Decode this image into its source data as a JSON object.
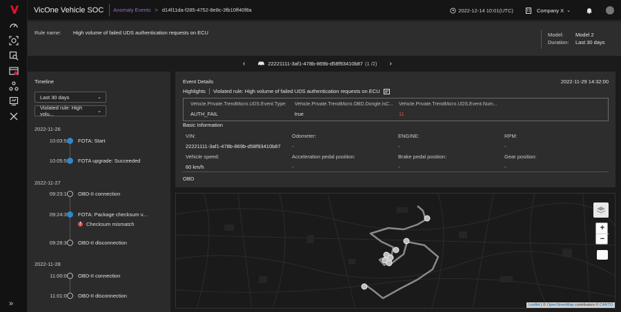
{
  "app": {
    "title": "VicOne Vehicle SOC"
  },
  "breadcrumb": {
    "parent": "Anomaly Events",
    "separator": ">",
    "current": "d14f11da-f285-4752-8e8c-3fb10ff40f8a"
  },
  "header": {
    "datetime": "2022-12-14 10:01(UTC)",
    "company": "Company X",
    "chevron": "⌄"
  },
  "sidebar": {
    "icons": [
      "dashboard-icon",
      "detection-icon",
      "investigation-icon",
      "events-icon",
      "network-icon",
      "report-icon",
      "tools-icon"
    ],
    "expand_label": "»"
  },
  "rule": {
    "label": "Rule name:",
    "name": "High volume of failed UDS authentication requests on ECU",
    "model_label": "Model:",
    "model_value": "Model 2",
    "duration_label": "Duration:",
    "duration_value": "Last 30 days"
  },
  "pager": {
    "prev": "‹",
    "next": "›",
    "vehicle_id": "22221111-3af1-478b-869b-d58f93410b87",
    "count": "(1 /2)"
  },
  "timeline": {
    "title": "Timeline",
    "range_select": "Last 30 days",
    "rule_select": "Violated rule: High volu...",
    "groups": [
      {
        "date": "2022-11-26",
        "items": [
          {
            "time": "10:03:52",
            "label": "FOTA: Start"
          },
          {
            "time": "10:05:55",
            "label": "FOTA upgrade: Succeeded"
          }
        ]
      },
      {
        "date": "2022-11-27",
        "items": [
          {
            "time": "09:23:10",
            "label": "OBD-II connection"
          },
          {
            "time": "09:24:37",
            "label": "FOTA: Package checksum v...",
            "warning": "Checksum mismatch"
          },
          {
            "time": "09:28:31",
            "label": "OBD-II disconnection"
          }
        ]
      },
      {
        "date": "2022-11-28",
        "items": [
          {
            "time": "11:00:00",
            "label": "OBD-II connection"
          },
          {
            "time": "11:01:00",
            "label": "OBD-II disconnection"
          }
        ]
      }
    ]
  },
  "event": {
    "title": "Event Details",
    "timestamp": "2022-11-29 14:32:00",
    "highlights_label": "Highlights",
    "violated_rule": "Violated rule: High volume of failed UDS authentication requests on ECU",
    "highlights": [
      {
        "key": "Vehicle.Private.TrendMicro.UDS.Event.Type:",
        "value": "AUTH_FAIL"
      },
      {
        "key": "Vehicle.Private.TrendMicro.OBD.Dongle.IsC...",
        "value": "true"
      },
      {
        "key": "Vehicle.Private.TrendMicro.UDS.Event.Num...",
        "value": "11"
      }
    ],
    "basic_title": "Basic Information",
    "basic": [
      {
        "key": "VIN:",
        "value": "22221111-3af1-478b-869b-d58f93410b87"
      },
      {
        "key": "Odometer:",
        "value": "-"
      },
      {
        "key": "ENGINE:",
        "value": "-"
      },
      {
        "key": "RPM:",
        "value": "-"
      },
      {
        "key": "Vehicle speed:",
        "value": "60 km/h"
      },
      {
        "key": "Acceleration pedal position:",
        "value": "-"
      },
      {
        "key": "Brake pedal position:",
        "value": "-"
      },
      {
        "key": "Gear position:",
        "value": "-"
      }
    ],
    "obd_label": "OBD"
  },
  "map": {
    "zoom_in": "+",
    "zoom_out": "−",
    "attribution_leaflet": "Leaflet",
    "attribution_sep": " | © ",
    "attribution_osm": "OpenStreetMap",
    "attribution_mid": " contributors © ",
    "attribution_carto": "CARTO"
  },
  "colors": {
    "accent_purple": "#9b6bd6",
    "timeline_blue": "#2f88c9",
    "alert_red": "#e0534f",
    "brand_red": "#e0102f"
  }
}
